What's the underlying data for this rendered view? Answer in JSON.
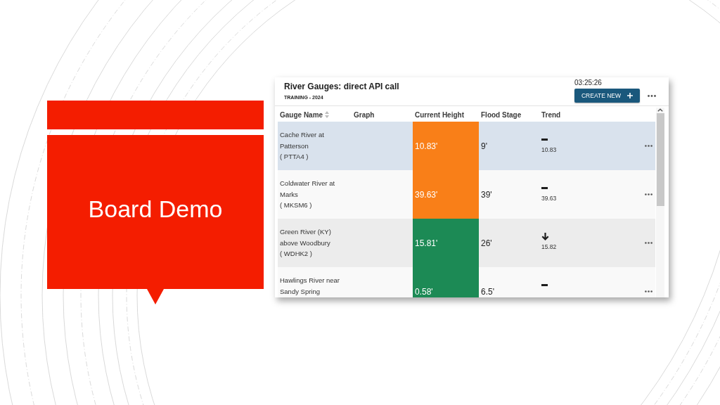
{
  "slide": {
    "title": "Board Demo"
  },
  "app": {
    "title": "River Gauges: direct API call",
    "subtitle": "TRAINING - 2024",
    "time": "03:25:26",
    "create_button": "CREATE NEW",
    "table": {
      "columns": [
        {
          "label": "Gauge Name",
          "sortable": true
        },
        {
          "label": "Graph",
          "sortable": false
        },
        {
          "label": "Current Height",
          "sortable": false
        },
        {
          "label": "Flood Stage",
          "sortable": false
        },
        {
          "label": "Trend",
          "sortable": false
        }
      ],
      "rows": [
        {
          "name": "Cache River at Patterson",
          "code": "( PTTA4 )",
          "current_height": "10.83'",
          "color": "#f97f18",
          "flood_stage": "9'",
          "trend": {
            "kind": "steady",
            "reading": "10.83"
          },
          "selected": true
        },
        {
          "name": "Coldwater River at Marks",
          "code": "( MKSM6 )",
          "current_height": "39.63'",
          "color": "#f97f18",
          "flood_stage": "39'",
          "trend": {
            "kind": "steady",
            "reading": "39.63"
          },
          "selected": false
        },
        {
          "name": "Green River (KY) above Woodbury",
          "code": "( WDHK2 )",
          "current_height": "15.81'",
          "color": "#1c8a55",
          "flood_stage": "26'",
          "trend": {
            "kind": "falling",
            "reading": "15.82"
          },
          "selected": false
        },
        {
          "name": "Hawlings River near Sandy Spring",
          "current_height": "0.58'",
          "color": "#1c8a55",
          "flood_stage": "6.5'",
          "trend": {
            "kind": "steady"
          },
          "selected": false
        }
      ]
    }
  }
}
